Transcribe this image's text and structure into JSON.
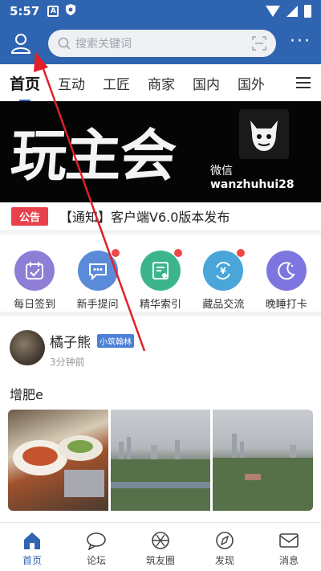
{
  "statusbar": {
    "time": "5:57",
    "icon_a": "A"
  },
  "topbar": {
    "search_placeholder": "搜索关键词",
    "more_label": "···"
  },
  "tabs": [
    {
      "label": "首页",
      "active": true
    },
    {
      "label": "互动"
    },
    {
      "label": "工匠"
    },
    {
      "label": "商家"
    },
    {
      "label": "国内"
    },
    {
      "label": "国外"
    }
  ],
  "banner": {
    "title": "玩主会",
    "wechat_label": "微信",
    "wechat_id": "wanzhuhui28"
  },
  "notice": {
    "badge": "公告",
    "text": "【通知】客户端V6.0版本发布"
  },
  "shortcuts": [
    {
      "label": "每日签到",
      "color": "#8f7ed6",
      "icon": "calendar-check-icon",
      "dot": false
    },
    {
      "label": "新手提问",
      "color": "#5b8bd8",
      "icon": "chat-bubble-icon",
      "dot": true
    },
    {
      "label": "精华索引",
      "color": "#3cb58a",
      "icon": "certificate-icon",
      "dot": true
    },
    {
      "label": "藏品交流",
      "color": "#4aa6d8",
      "icon": "yuan-exchange-icon",
      "dot": true
    },
    {
      "label": "晚睡打卡",
      "color": "#7e76e0",
      "icon": "moon-icon",
      "dot": false
    }
  ],
  "post": {
    "author": "橘子熊",
    "badge": "小筑翰林",
    "time": "3分钟前",
    "text": "增肥e"
  },
  "bottom_nav": [
    {
      "label": "首页",
      "icon": "home-icon",
      "active": true
    },
    {
      "label": "论坛",
      "icon": "chat-icon"
    },
    {
      "label": "筑友圈",
      "icon": "aperture-icon"
    },
    {
      "label": "发现",
      "icon": "compass-icon"
    },
    {
      "label": "消息",
      "icon": "mail-icon"
    }
  ],
  "colors": {
    "brand": "#2f64b0",
    "notice_badge": "#e8414b",
    "dot": "#f04848",
    "arrow": "#e0202a"
  }
}
